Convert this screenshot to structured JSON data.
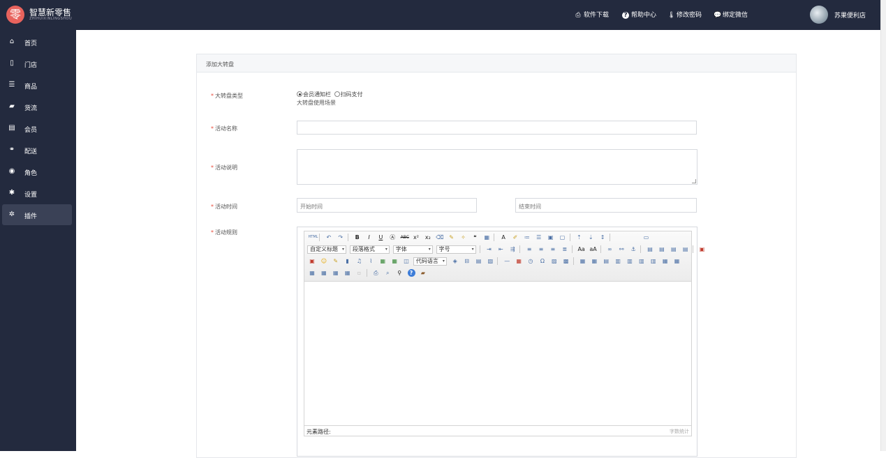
{
  "header": {
    "logo_glyph": "零",
    "brand": "智慧新零售",
    "brand_sub": "ZHIHUIXINLINGSHOU",
    "links": [
      {
        "label": "软件下载",
        "icon": "printer-icon"
      },
      {
        "label": "帮助中心",
        "icon": "question-circle-icon"
      },
      {
        "label": "修改密码",
        "icon": "thermometer-icon"
      },
      {
        "label": "绑定微信",
        "icon": "chat-bubbles-icon"
      }
    ],
    "store_name": "苏果便利店"
  },
  "sidebar": {
    "items": [
      {
        "label": "首页",
        "icon": "home-icon"
      },
      {
        "label": "门店",
        "icon": "building-icon"
      },
      {
        "label": "商品",
        "icon": "list-icon"
      },
      {
        "label": "货流",
        "icon": "truck-icon"
      },
      {
        "label": "会员",
        "icon": "id-card-icon"
      },
      {
        "label": "配送",
        "icon": "motorcycle-icon"
      },
      {
        "label": "角色",
        "icon": "user-circle-icon"
      },
      {
        "label": "设置",
        "icon": "gear-icon"
      },
      {
        "label": "插件",
        "icon": "gears-icon"
      }
    ],
    "active_index": 8
  },
  "form": {
    "panel_title": "添加大转盘",
    "required_mark": "*",
    "type_label": "大转盘类型",
    "type_options": [
      "会员通知栏",
      "扫码支付"
    ],
    "type_selected": "会员通知栏",
    "type_hint": "大转盘使用场景",
    "name_label": "活动名称",
    "name_value": "",
    "desc_label": "活动说明",
    "desc_value": "",
    "time_label": "活动时间",
    "start_placeholder": "开始时间",
    "end_placeholder": "结束时间",
    "rules_label": "活动规则"
  },
  "editor": {
    "selects": {
      "heading": "自定义标题",
      "paragraph": "段落格式",
      "font": "字体",
      "size": "字号",
      "code": "代码语言"
    },
    "path_label": "元素路径:",
    "word_count_label": "字数统计"
  },
  "colors": {
    "nav_bg": "#232a3e",
    "nav_active": "#3a4156",
    "required": "#e74c3c",
    "logo": "#e8635d"
  }
}
